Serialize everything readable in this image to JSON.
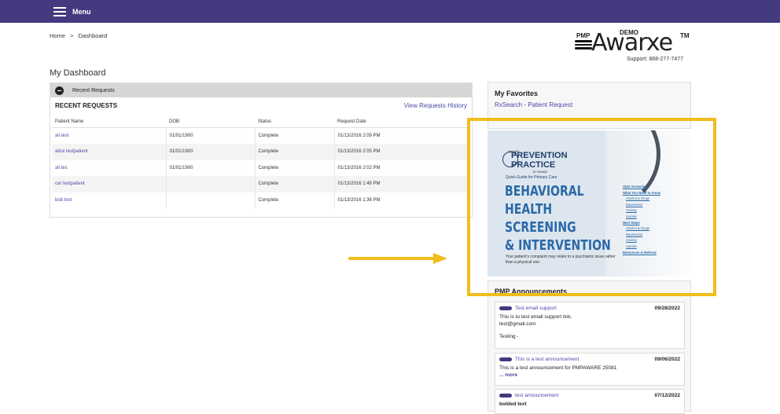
{
  "topbar": {
    "menu_label": "Menu"
  },
  "breadcrumb": {
    "home": "Home",
    "separator": ">",
    "current": "Dashboard"
  },
  "logo": {
    "pmp": "PMP",
    "demo": "DEMO",
    "name": "Awarxe",
    "tm": "TM"
  },
  "support": "Support: 888-277-7477",
  "page_title": "My Dashboard",
  "recent_requests": {
    "panel_label": "Recent Requests",
    "title": "RECENT REQUESTS",
    "history_link": "View Requests History",
    "columns": [
      "Patient Name",
      "DOB",
      "Status",
      "Request Date"
    ],
    "rows": [
      {
        "name": "ali test",
        "dob": "01/01/1900",
        "status": "Complete",
        "date": "01/13/2016 2:09 PM"
      },
      {
        "name": "alice testpatient",
        "dob": "01/01/1900",
        "status": "Complete",
        "date": "01/13/2016 2:05 PM"
      },
      {
        "name": "ali tes",
        "dob": "01/01/1900",
        "status": "Complete",
        "date": "01/13/2016 2:02 PM"
      },
      {
        "name": "car testpatient",
        "dob": "",
        "status": "Complete",
        "date": "01/13/2016 1:49 PM"
      },
      {
        "name": "bob test",
        "dob": "",
        "status": "Complete",
        "date": "01/13/2016 1:36 PM"
      }
    ]
  },
  "favorites": {
    "title": "My Favorites",
    "link": "RxSearch - Patient Request"
  },
  "promo": {
    "small_top": "WebMD",
    "brand_line1": "PREVENTION",
    "brand_line2": "PRACTICE",
    "brand_in": "in",
    "brand_by": "BY WebMD",
    "guide": "Quick Guide for Primary Care",
    "headline": [
      "BEHAVIORAL",
      "HEALTH",
      "SCREENING",
      "& INTERVENTION"
    ],
    "desc": "Your patient's complaint may relate to a psychiatric issue rather than a physical one.",
    "list": [
      {
        "text": "Start Screening",
        "type": "h"
      },
      {
        "text": "What You Need to Know",
        "type": "h"
      },
      {
        "text": "Alcohol & Drugs",
        "type": "s"
      },
      {
        "text": "Depression",
        "type": "s"
      },
      {
        "text": "Anxiety",
        "type": "s"
      },
      {
        "text": "Suicide",
        "type": "s"
      },
      {
        "text": "Next Steps",
        "type": "h"
      },
      {
        "text": "Alcohol & Drugs",
        "type": "s"
      },
      {
        "text": "Depression",
        "type": "s"
      },
      {
        "text": "Anxiety",
        "type": "s"
      },
      {
        "text": "Suicide",
        "type": "s"
      },
      {
        "text": "Resources & Referral",
        "type": "h"
      }
    ]
  },
  "announcements": {
    "title": "PMP Announcements",
    "items": [
      {
        "subject": "Test email support",
        "date": "09/28/2022",
        "body": [
          "This is to test email support link.",
          "test@gmail.com",
          "",
          "Testing -"
        ],
        "more": ""
      },
      {
        "subject": "This is a test announcement",
        "date": "09/06/2022",
        "body": [
          "This is a test announcement for PMPAWARE 25081"
        ],
        "more": "... more"
      },
      {
        "subject": "test announcement",
        "date": "07/12/2022",
        "body": [
          "bolded text"
        ],
        "more": ""
      }
    ]
  },
  "colors": {
    "topbar": "#433a80",
    "link": "#4a4aa8",
    "highlight": "#f1bd1c",
    "arrow": "#f1bd1c"
  }
}
